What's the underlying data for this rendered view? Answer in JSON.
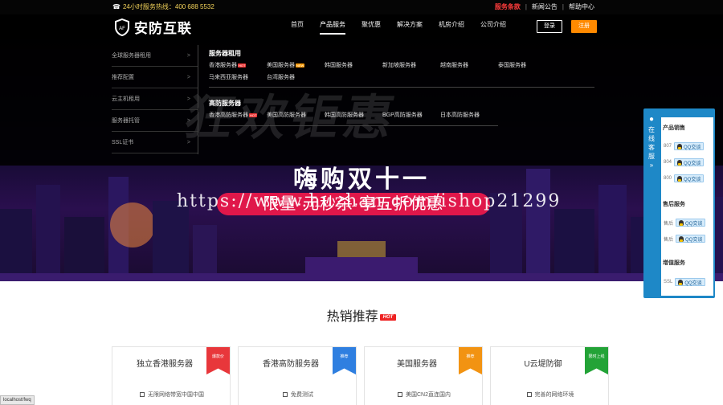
{
  "topbar": {
    "hotline": "24小时服务热线：400 688 5532",
    "links": [
      "服务条款",
      "新闻公告",
      "帮助中心"
    ]
  },
  "header": {
    "logo_mark": "AF",
    "logo_text": "安防互联",
    "nav": [
      "首页",
      "产品服务",
      "聚优惠",
      "解决方案",
      "机房介绍",
      "公司介绍"
    ],
    "login": "登录",
    "register": "注册"
  },
  "dropdown": {
    "side_menu": [
      "全球服务器租用",
      "推荐配置",
      "云主机租用",
      "服务器托管",
      "SSL证书"
    ],
    "server_rental": {
      "title": "服务器租用",
      "links": [
        {
          "label": "香港服务器",
          "tag": "HOT"
        },
        {
          "label": "美国服务器",
          "tag": "NEW"
        },
        {
          "label": "韩国服务器",
          "tag": ""
        },
        {
          "label": "新加坡服务器",
          "tag": ""
        },
        {
          "label": "越南服务器",
          "tag": ""
        },
        {
          "label": "泰国服务器",
          "tag": ""
        },
        {
          "label": "马来西亚服务器",
          "tag": ""
        },
        {
          "label": "台湾服务器",
          "tag": ""
        }
      ]
    },
    "ddos_servers": {
      "title": "高防服务器",
      "links": [
        {
          "label": "香港高防服务器",
          "tag": "HOT"
        },
        {
          "label": "美国高防服务器",
          "tag": ""
        },
        {
          "label": "韩国高防服务器",
          "tag": ""
        },
        {
          "label": "BGP高防服务器",
          "tag": ""
        },
        {
          "label": "日本高防服务器",
          "tag": ""
        }
      ]
    }
  },
  "banner": {
    "title": "嗨购双十一",
    "promo": "限量·元秒杀·享五折优惠",
    "watermark": "https://www.huzhan.com/ishop21299",
    "ghost_text": "狂欢钜惠"
  },
  "service_panel": {
    "tab_label": "在线客服",
    "groups": [
      {
        "title": "产品销售",
        "rows": [
          {
            "label": "807",
            "qq": "QQ交谈"
          },
          {
            "label": "804",
            "qq": "QQ交谈"
          },
          {
            "label": "800",
            "qq": "QQ交谈"
          }
        ]
      },
      {
        "title": "售后服务",
        "rows": [
          {
            "label": "售后",
            "qq": "QQ交谈"
          },
          {
            "label": "售后",
            "qq": "QQ交谈"
          }
        ]
      },
      {
        "title": "增值服务",
        "rows": [
          {
            "label": "SSL",
            "qq": "QQ交谈"
          }
        ]
      }
    ]
  },
  "hot_section": {
    "title": "热销推荐",
    "badge": "HOT",
    "cards": [
      {
        "name": "独立香港服务器",
        "ribbon": "爆款价",
        "color": "#e8373b",
        "feature": "无限网络带宽中国中国"
      },
      {
        "name": "香港高防服务器",
        "ribbon": "推荐",
        "color": "#2f7fe0",
        "feature": "免费测试"
      },
      {
        "name": "美国服务器",
        "ribbon": "推荐",
        "color": "#f29312",
        "feature": "美国CN2直连国内"
      },
      {
        "name": "U云堤防御",
        "ribbon": "限时上线",
        "color": "#23a337",
        "feature": "完善的网络环境"
      }
    ]
  },
  "status_bar": "localhost/fwq"
}
